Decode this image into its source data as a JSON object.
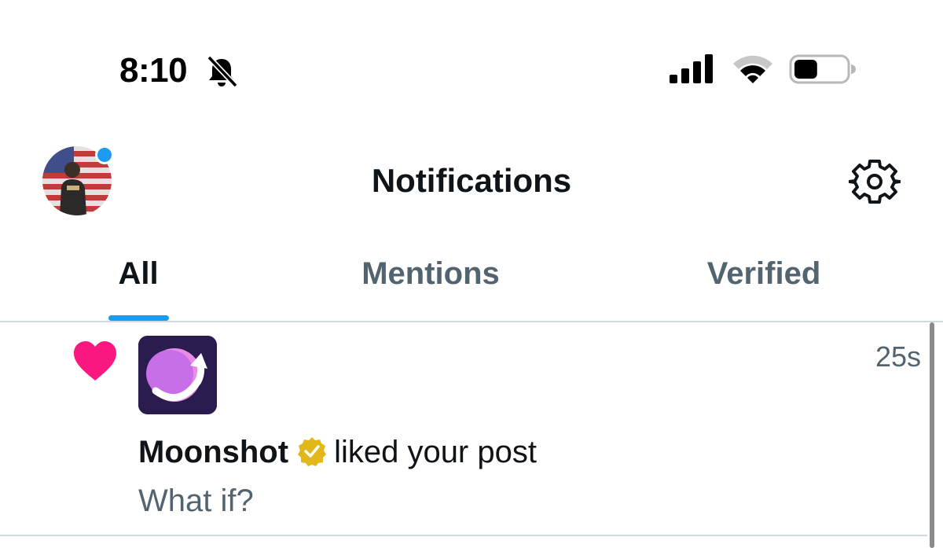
{
  "status_bar": {
    "time": "8:10",
    "mute_icon": "bell-slash-icon",
    "signal_icon": "cellular-signal-icon",
    "wifi_icon": "wifi-icon",
    "battery_icon": "battery-icon",
    "battery_level": 0.45
  },
  "header": {
    "title": "Notifications",
    "avatar_icon": "profile-avatar",
    "settings_icon": "gear-icon",
    "avatar_dot_color": "#1d9bf0"
  },
  "tabs": [
    {
      "label": "All",
      "active": true
    },
    {
      "label": "Mentions",
      "active": false
    },
    {
      "label": "Verified",
      "active": false
    }
  ],
  "notifications": [
    {
      "type_icon": "heart-icon",
      "app_icon": "moonshot-logo",
      "actor": "Moonshot",
      "verified_badge": "gold-verified-badge-icon",
      "action": "liked your post",
      "time": "25s",
      "post_text": "What if?"
    }
  ],
  "colors": {
    "accent": "#1d9bf0",
    "like": "#f91880",
    "verified_gold": "#e2b719",
    "secondary_text": "#536471"
  }
}
